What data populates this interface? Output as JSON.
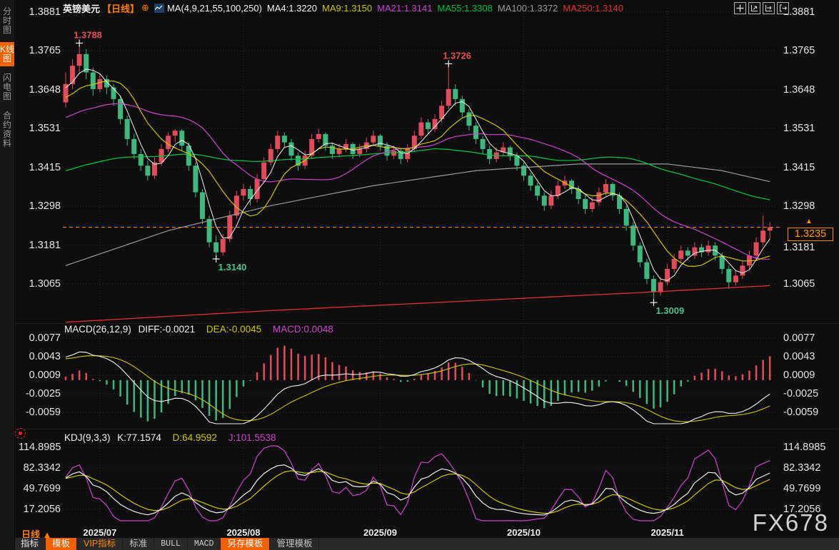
{
  "colors": {
    "accent_orange": "#ff7d00",
    "badge_orange": "#ff9000",
    "up_red": "#e24b5c",
    "down_green": "#3fb87f",
    "white": "#f2f2f2",
    "yellow": "#c9c900",
    "magenta": "#d042d0",
    "green": "#00c040",
    "gray": "#9a9a9a",
    "red": "#e03030"
  },
  "sidebar": {
    "items": [
      {
        "label": "分时图",
        "active": false
      },
      {
        "label": "K线图",
        "active": true
      },
      {
        "label": "闪电图",
        "active": false
      },
      {
        "label": "合约资料",
        "active": false
      }
    ]
  },
  "header": {
    "symbol": "英镑美元",
    "period_tag": "【日线】",
    "plus_icon": "⊕",
    "ma_settings": "MA(4,9,21,55,100,250)",
    "ma_values": [
      {
        "label": "MA4:1.3220",
        "color": "#f2f2f2"
      },
      {
        "label": "MA9:1.3150",
        "color": "#c9c900"
      },
      {
        "label": "MA21:1.3141",
        "color": "#d042d0"
      },
      {
        "label": "MA55:1.3308",
        "color": "#00c040"
      },
      {
        "label": "MA100:1.3372",
        "color": "#9a9a9a"
      },
      {
        "label": "MA250:1.3140",
        "color": "#e03030"
      }
    ],
    "toolbar_icons": [
      "move-icon",
      "axis-zoom-icon",
      "axis-pan-icon",
      "exit-chart-icon"
    ]
  },
  "axes": {
    "main": [
      "1.3881",
      "1.3765",
      "1.3648",
      "1.3531",
      "1.3415",
      "1.3298",
      "1.3181",
      "1.3065"
    ],
    "macd": [
      "0.0077",
      "0.0043",
      "0.0009",
      "-0.0025",
      "-0.0059"
    ],
    "kdj": [
      "114.8985",
      "82.3342",
      "49.7699",
      "17.2056"
    ]
  },
  "price_marker": {
    "label": "1.3235",
    "price": 1.3235,
    "arrow": "▲"
  },
  "annotations": [
    {
      "text": "1.3788",
      "idx": 2,
      "price": 1.3788,
      "place": "above",
      "color": "#e34f4f"
    },
    {
      "text": "1.3726",
      "idx": 56,
      "price": 1.3726,
      "place": "above",
      "color": "#e34f4f"
    },
    {
      "text": "1.3140",
      "idx": 22,
      "price": 1.314,
      "place": "below",
      "color": "#4fc08d"
    },
    {
      "text": "1.3009",
      "idx": 86,
      "price": 1.3009,
      "place": "below",
      "color": "#4fc08d"
    }
  ],
  "panels": {
    "macd": {
      "title": "MACD(26,12,9)",
      "diff": "DIFF:-0.0021",
      "dea": "DEA:-0.0045",
      "macd": "MACD:0.0048"
    },
    "kdj": {
      "title": "KDJ(9,3,3)",
      "k": "K:77.1574",
      "d": "D:64.9592",
      "j": "J:101.5538"
    }
  },
  "timeline": {
    "period_label": "日线 ▲",
    "months": [
      "2025/07",
      "2025/08",
      "2025/09",
      "2025/10",
      "2025/11"
    ],
    "tick_indices": [
      5,
      26,
      46,
      67,
      88
    ]
  },
  "tabs": [
    {
      "label": "指标",
      "style": "plain"
    },
    {
      "label": "模板",
      "style": "active"
    },
    {
      "label": "VIP指标",
      "style": "orange-text"
    },
    {
      "label": "标准",
      "style": "muted"
    },
    {
      "label": "BULL",
      "style": "mono"
    },
    {
      "label": "MACD",
      "style": "mono"
    },
    {
      "label": "另存模板",
      "style": "active"
    },
    {
      "label": "管理模板",
      "style": "muted"
    }
  ],
  "watermark": "FX678",
  "chart_data": {
    "type": "candlestick",
    "title": "英镑美元 日线 (GBP/USD daily)",
    "price_axis": {
      "top": 1.3881,
      "bottom": 1.3065,
      "ticks": [
        1.3881,
        1.3765,
        1.3648,
        1.3531,
        1.3415,
        1.3298,
        1.3181,
        1.3065
      ]
    },
    "macd_axis_ticks": [
      0.0077,
      0.0043,
      0.0009,
      -0.0025,
      -0.0059
    ],
    "kdj_axis_ticks": [
      114.8985,
      82.3342,
      49.7699,
      17.2056
    ],
    "current_price": 1.3235,
    "candles": [
      [
        1.361,
        1.37,
        1.3595,
        1.3665
      ],
      [
        1.3665,
        1.374,
        1.365,
        1.372
      ],
      [
        1.372,
        1.3788,
        1.37,
        1.3755
      ],
      [
        1.3755,
        1.377,
        1.368,
        1.37
      ],
      [
        1.37,
        1.3715,
        1.363,
        1.365
      ],
      [
        1.365,
        1.3695,
        1.364,
        1.368
      ],
      [
        1.368,
        1.369,
        1.3635,
        1.3655
      ],
      [
        1.3655,
        1.3665,
        1.36,
        1.362
      ],
      [
        1.362,
        1.363,
        1.3545,
        1.356
      ],
      [
        1.356,
        1.357,
        1.348,
        1.35
      ],
      [
        1.35,
        1.3515,
        1.344,
        1.3455
      ],
      [
        1.3455,
        1.347,
        1.3405,
        1.342
      ],
      [
        1.342,
        1.3435,
        1.3375,
        1.339
      ],
      [
        1.339,
        1.3445,
        1.338,
        1.343
      ],
      [
        1.343,
        1.3485,
        1.342,
        1.347
      ],
      [
        1.347,
        1.352,
        1.346,
        1.351
      ],
      [
        1.351,
        1.353,
        1.349,
        1.3525
      ],
      [
        1.3525,
        1.353,
        1.3465,
        1.348
      ],
      [
        1.348,
        1.349,
        1.3405,
        1.342
      ],
      [
        1.342,
        1.343,
        1.3325,
        1.334
      ],
      [
        1.334,
        1.335,
        1.3245,
        1.326
      ],
      [
        1.326,
        1.327,
        1.3175,
        1.319
      ],
      [
        1.319,
        1.321,
        1.314,
        1.316
      ],
      [
        1.316,
        1.3215,
        1.315,
        1.32
      ],
      [
        1.32,
        1.3285,
        1.319,
        1.327
      ],
      [
        1.327,
        1.3345,
        1.326,
        1.333
      ],
      [
        1.333,
        1.3365,
        1.3315,
        1.335
      ],
      [
        1.335,
        1.336,
        1.33,
        1.332
      ],
      [
        1.332,
        1.3395,
        1.331,
        1.338
      ],
      [
        1.338,
        1.3445,
        1.337,
        1.343
      ],
      [
        1.343,
        1.3485,
        1.342,
        1.347
      ],
      [
        1.347,
        1.3525,
        1.346,
        1.351
      ],
      [
        1.351,
        1.352,
        1.3475,
        1.349
      ],
      [
        1.349,
        1.35,
        1.3435,
        1.345
      ],
      [
        1.345,
        1.346,
        1.3405,
        1.342
      ],
      [
        1.342,
        1.3465,
        1.341,
        1.345
      ],
      [
        1.345,
        1.3515,
        1.344,
        1.35
      ],
      [
        1.35,
        1.353,
        1.349,
        1.3515
      ],
      [
        1.3515,
        1.352,
        1.3465,
        1.348
      ],
      [
        1.348,
        1.349,
        1.344,
        1.3455
      ],
      [
        1.3455,
        1.3485,
        1.3445,
        1.347
      ],
      [
        1.347,
        1.35,
        1.346,
        1.3485
      ],
      [
        1.3485,
        1.349,
        1.344,
        1.3455
      ],
      [
        1.3455,
        1.3485,
        1.3445,
        1.347
      ],
      [
        1.347,
        1.3505,
        1.346,
        1.349
      ],
      [
        1.349,
        1.3525,
        1.348,
        1.351
      ],
      [
        1.351,
        1.3515,
        1.3465,
        1.348
      ],
      [
        1.348,
        1.349,
        1.3435,
        1.345
      ],
      [
        1.345,
        1.348,
        1.344,
        1.3465
      ],
      [
        1.3465,
        1.347,
        1.3425,
        1.344
      ],
      [
        1.344,
        1.3485,
        1.343,
        1.347
      ],
      [
        1.347,
        1.3525,
        1.346,
        1.351
      ],
      [
        1.351,
        1.3565,
        1.35,
        1.355
      ],
      [
        1.355,
        1.356,
        1.3515,
        1.353
      ],
      [
        1.353,
        1.3575,
        1.352,
        1.356
      ],
      [
        1.356,
        1.3615,
        1.355,
        1.36
      ],
      [
        1.36,
        1.3726,
        1.359,
        1.365
      ],
      [
        1.365,
        1.3665,
        1.36,
        1.362
      ],
      [
        1.362,
        1.363,
        1.3565,
        1.358
      ],
      [
        1.358,
        1.359,
        1.3525,
        1.354
      ],
      [
        1.354,
        1.355,
        1.3485,
        1.35
      ],
      [
        1.35,
        1.351,
        1.3455,
        1.347
      ],
      [
        1.347,
        1.348,
        1.3425,
        1.344
      ],
      [
        1.344,
        1.3475,
        1.343,
        1.346
      ],
      [
        1.346,
        1.349,
        1.345,
        1.3475
      ],
      [
        1.3475,
        1.348,
        1.3435,
        1.345
      ],
      [
        1.345,
        1.346,
        1.3405,
        1.342
      ],
      [
        1.342,
        1.343,
        1.3375,
        1.339
      ],
      [
        1.339,
        1.34,
        1.3345,
        1.336
      ],
      [
        1.336,
        1.337,
        1.3315,
        1.333
      ],
      [
        1.333,
        1.334,
        1.3285,
        1.33
      ],
      [
        1.33,
        1.3345,
        1.329,
        1.333
      ],
      [
        1.333,
        1.3375,
        1.332,
        1.336
      ],
      [
        1.336,
        1.339,
        1.335,
        1.3375
      ],
      [
        1.3375,
        1.338,
        1.3335,
        1.335
      ],
      [
        1.335,
        1.336,
        1.3305,
        1.332
      ],
      [
        1.332,
        1.333,
        1.3275,
        1.329
      ],
      [
        1.329,
        1.3325,
        1.328,
        1.331
      ],
      [
        1.331,
        1.3355,
        1.33,
        1.334
      ],
      [
        1.334,
        1.338,
        1.333,
        1.3365
      ],
      [
        1.3365,
        1.337,
        1.3315,
        1.333
      ],
      [
        1.333,
        1.334,
        1.3275,
        1.329
      ],
      [
        1.329,
        1.33,
        1.3225,
        1.324
      ],
      [
        1.324,
        1.325,
        1.3165,
        1.318
      ],
      [
        1.318,
        1.319,
        1.3115,
        1.313
      ],
      [
        1.313,
        1.314,
        1.3065,
        1.308
      ],
      [
        1.308,
        1.309,
        1.3009,
        1.304
      ],
      [
        1.304,
        1.3085,
        1.303,
        1.307
      ],
      [
        1.307,
        1.3125,
        1.306,
        1.311
      ],
      [
        1.311,
        1.3155,
        1.31,
        1.314
      ],
      [
        1.314,
        1.318,
        1.313,
        1.3165
      ],
      [
        1.3165,
        1.3175,
        1.3135,
        1.315
      ],
      [
        1.315,
        1.319,
        1.314,
        1.3175
      ],
      [
        1.3175,
        1.3185,
        1.3145,
        1.316
      ],
      [
        1.316,
        1.3195,
        1.315,
        1.318
      ],
      [
        1.318,
        1.319,
        1.3135,
        1.315
      ],
      [
        1.315,
        1.316,
        1.3095,
        1.311
      ],
      [
        1.311,
        1.312,
        1.305,
        1.307
      ],
      [
        1.307,
        1.3105,
        1.306,
        1.309
      ],
      [
        1.309,
        1.3135,
        1.308,
        1.312
      ],
      [
        1.312,
        1.3165,
        1.311,
        1.315
      ],
      [
        1.315,
        1.3205,
        1.314,
        1.319
      ],
      [
        1.319,
        1.327,
        1.318,
        1.3225
      ],
      [
        1.3225,
        1.325,
        1.32,
        1.3235
      ]
    ],
    "ma_seeds": {
      "ma4": 1.365,
      "ma9": 1.362,
      "ma21": 1.356,
      "ma55": 1.34
    },
    "ma100_points": [
      [
        0,
        1.312
      ],
      [
        15,
        1.3225
      ],
      [
        30,
        1.33
      ],
      [
        45,
        1.336
      ],
      [
        60,
        1.3405
      ],
      [
        75,
        1.3425
      ],
      [
        88,
        1.3425
      ],
      [
        96,
        1.3405
      ],
      [
        103,
        1.3372
      ]
    ],
    "ma250_points": [
      [
        0,
        1.295
      ],
      [
        30,
        1.2985
      ],
      [
        60,
        1.3015
      ],
      [
        85,
        1.304
      ],
      [
        103,
        1.306
      ]
    ],
    "macd_prehistory": {
      "bars": 30,
      "start": 1.345,
      "end": 1.3665
    }
  }
}
